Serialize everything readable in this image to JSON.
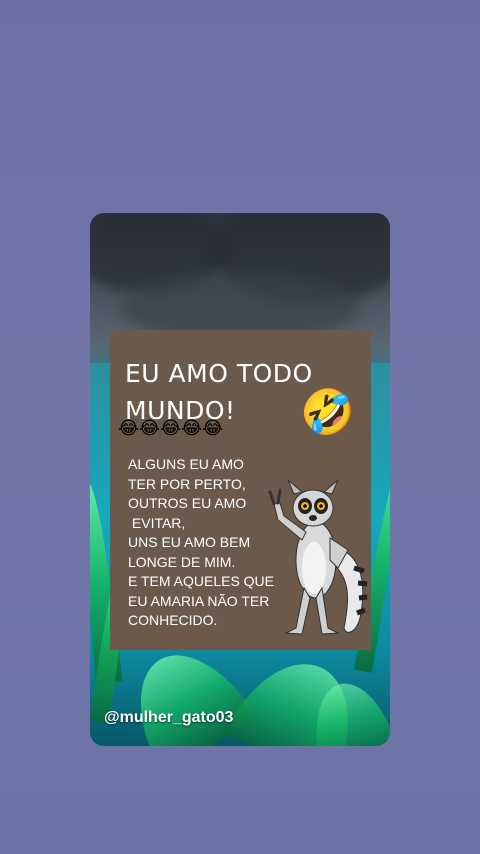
{
  "post": {
    "title": "EU AMO TODO MUNDO!",
    "laugh_emoji": "🤣",
    "small_emojis": "😂😂😂😂😂",
    "body_text": "ALGUNS EU AMO\nTER POR PERTO,\nOUTROS EU AMO\n EVITAR,\nUNS EU AMO BEM\nLONGE DE MIM.\nE TEM AQUELES QUE\nEU AMARIA NÃO TER\nCONHECIDO.",
    "watermark": "@mulher_gato03"
  },
  "colors": {
    "page_background": "#6d70a6",
    "panel_background": "#6b5a4b",
    "text": "#ffffff"
  },
  "icons": {
    "character": "lemur-illustration"
  }
}
